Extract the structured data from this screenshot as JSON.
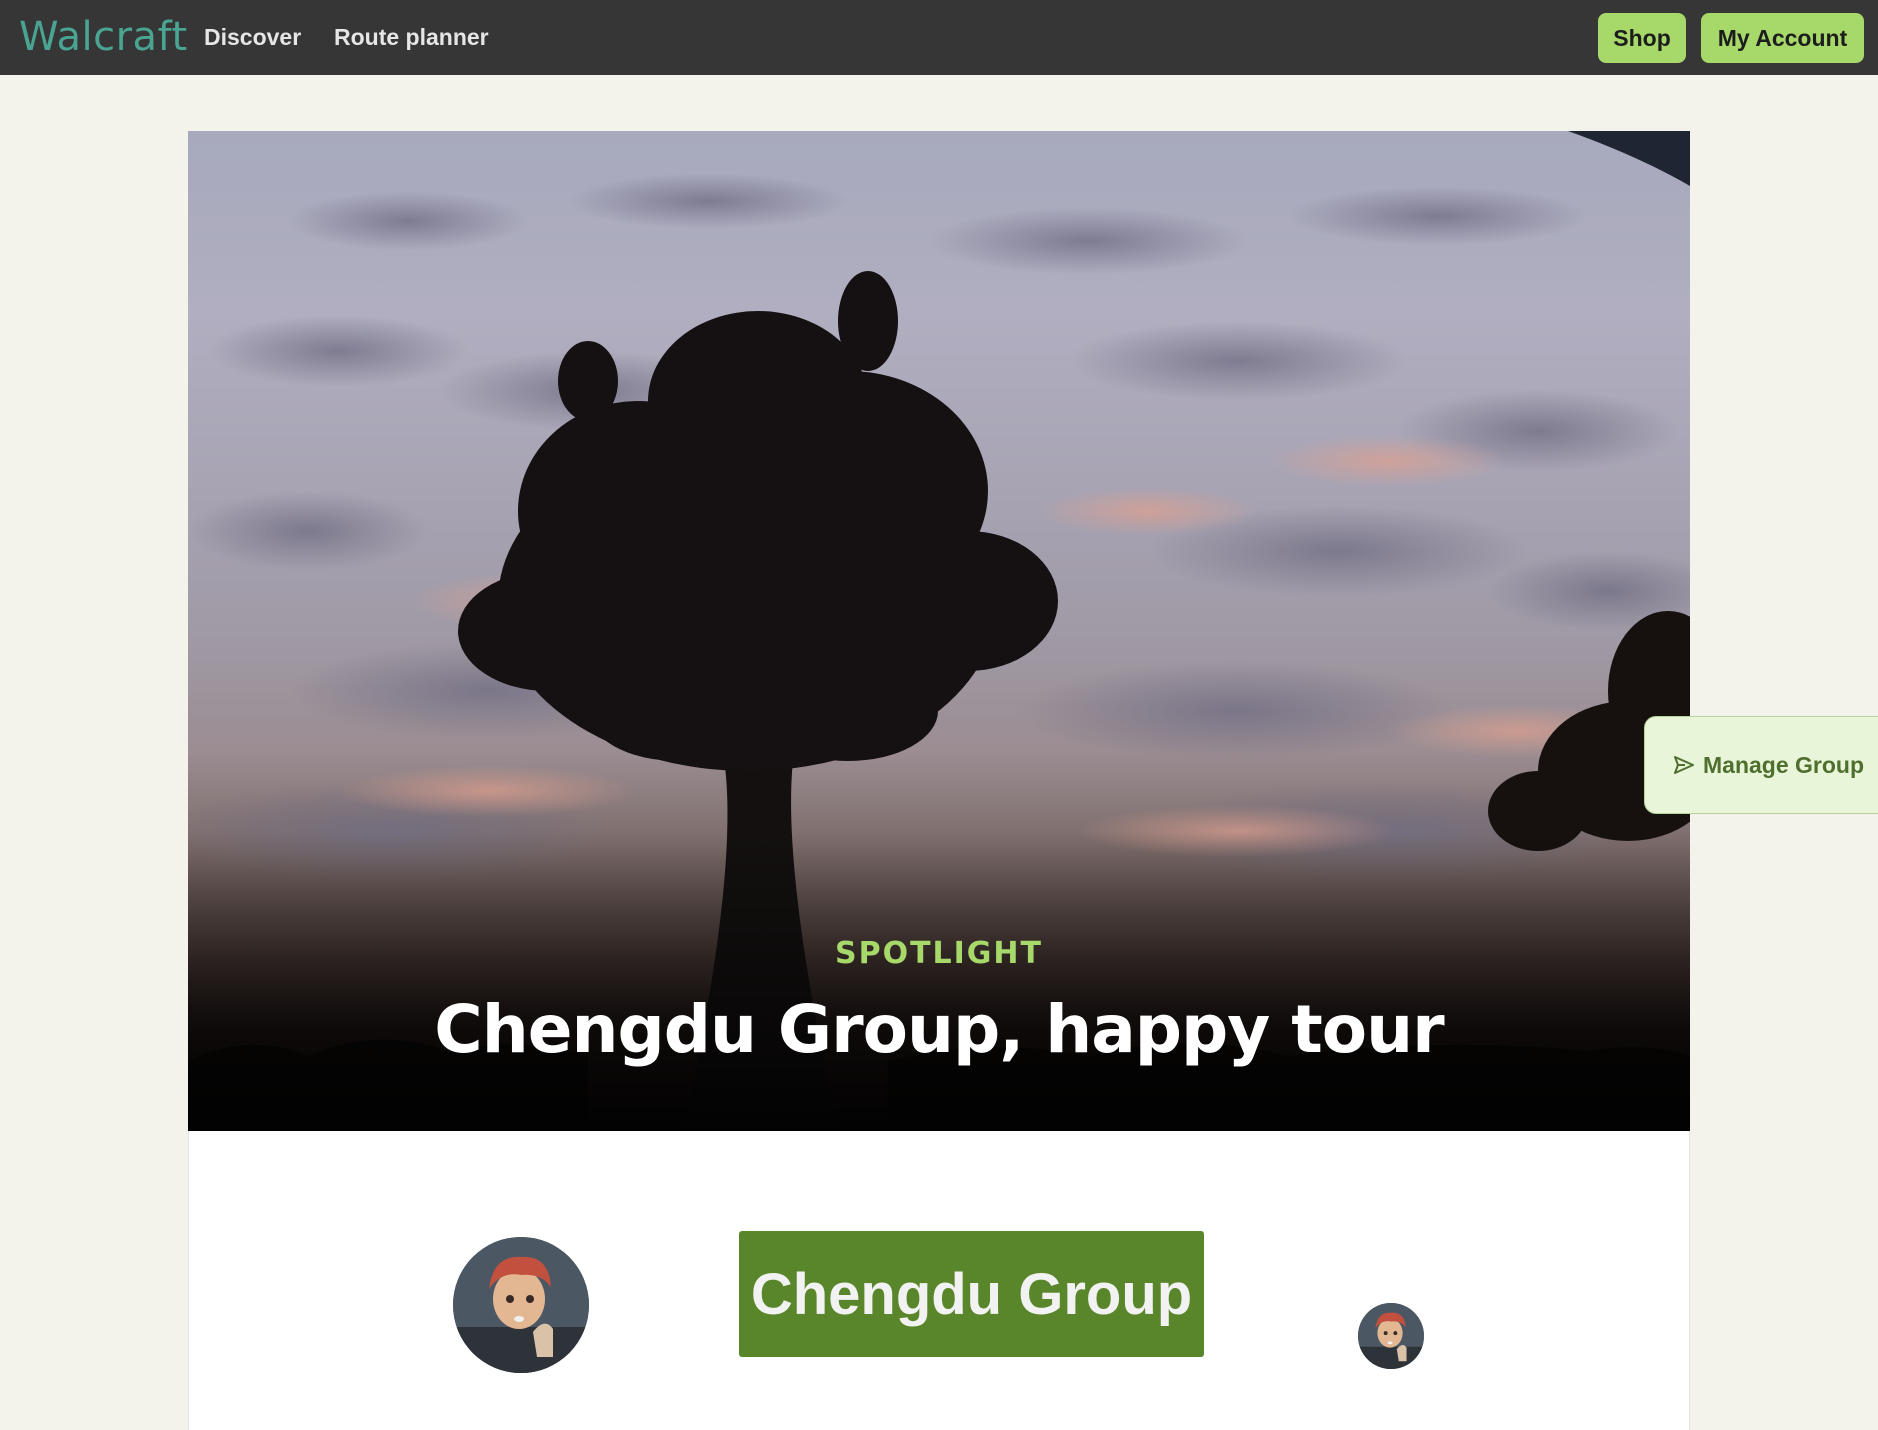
{
  "nav": {
    "logo": "Walcraft",
    "links": [
      "Discover",
      "Route planner"
    ],
    "shop_label": "Shop",
    "account_label": "My Account"
  },
  "hero": {
    "label": "SPOTLIGHT",
    "title": "Chengdu Group, happy tour"
  },
  "manage": {
    "label": "Manage Group",
    "icon": "send-icon"
  },
  "group": {
    "name": "Chengdu Group"
  },
  "colors": {
    "nav_bg": "#363636",
    "accent": "#a6d96a",
    "logo": "#49a492",
    "group_badge": "#5a862b",
    "page_bg": "#f3f3ec"
  }
}
